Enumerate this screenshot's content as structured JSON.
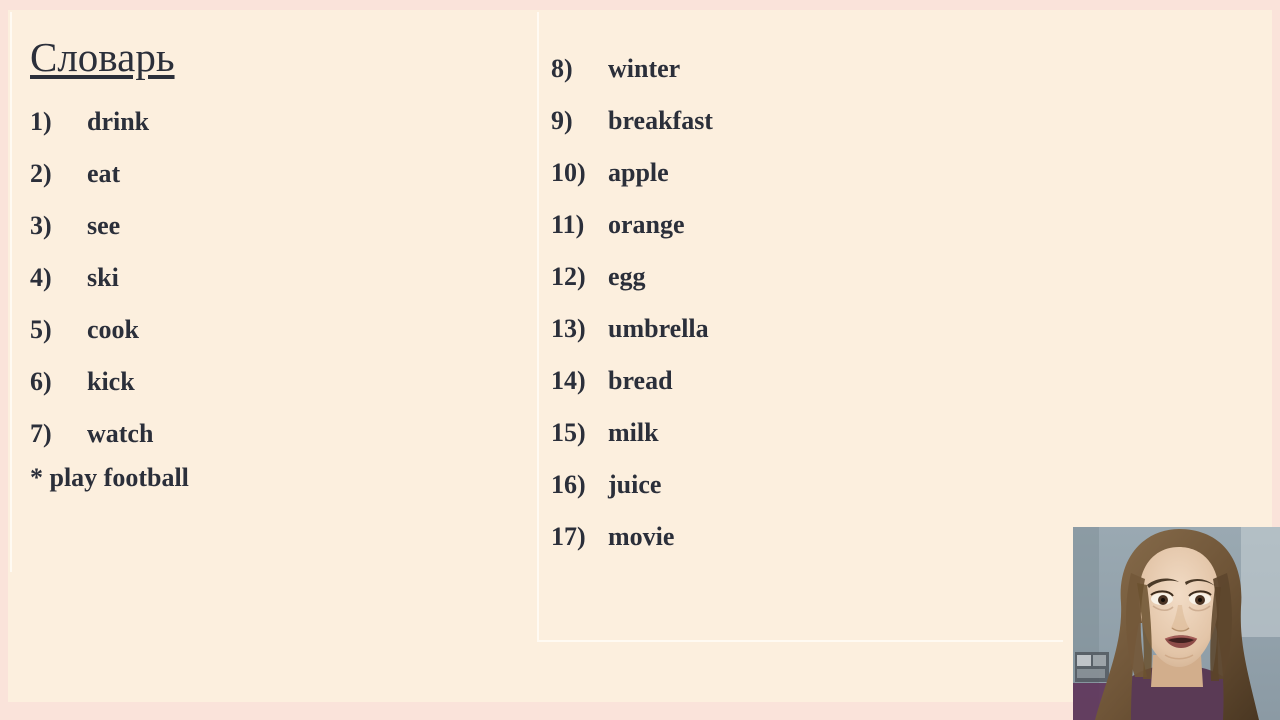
{
  "slide": {
    "title": "Словарь",
    "footnote": "* play football",
    "left_items": [
      {
        "num": "1)",
        "word": "drink"
      },
      {
        "num": "2)",
        "word": "eat"
      },
      {
        "num": "3)",
        "word": "see"
      },
      {
        "num": "4)",
        "word": "ski"
      },
      {
        "num": "5)",
        "word": "cook"
      },
      {
        "num": "6)",
        "word": "kick"
      },
      {
        "num": "7)",
        "word": "watch"
      }
    ],
    "right_items": [
      {
        "num": "8)",
        "word": "winter"
      },
      {
        "num": "9)",
        "word": "breakfast"
      },
      {
        "num": "10)",
        "word": "apple"
      },
      {
        "num": "11)",
        "word": "orange"
      },
      {
        "num": "12)",
        "word": "egg"
      },
      {
        "num": "13)",
        "word": "umbrella"
      },
      {
        "num": "14)",
        "word": "bread"
      },
      {
        "num": "15)",
        "word": "milk"
      },
      {
        "num": "16)",
        "word": "juice"
      },
      {
        "num": "17)",
        "word": "movie"
      }
    ]
  },
  "colors": {
    "slide_background": "#fcefde",
    "frame_background": "#fae3da",
    "text": "#2b2f3a",
    "placeholder_border": "#fffaf2"
  },
  "webcam": {
    "label": "presenter-webcam"
  }
}
